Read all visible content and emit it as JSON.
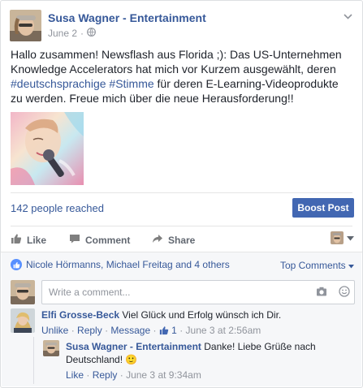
{
  "header": {
    "page_name": "Susa Wagner - Entertainment",
    "date": "June 2",
    "sep": "·"
  },
  "post": {
    "text_part1": "Hallo zusammen! Newsflash aus Florida ;): Das US-Unternehmen Knowledge Accelerators hat mich vor Kurzem ausgewählt, deren ",
    "hashtag1": "#deutschsprachige",
    "space": " ",
    "hashtag2": "#Stimme",
    "text_part2": " für deren E-Learning-Videoprodukte zu werden. Freue mich über die neue Herausforderung!!"
  },
  "insights": {
    "reach": "142 people reached",
    "boost_label": "Boost Post"
  },
  "actions": {
    "like": "Like",
    "comment": "Comment",
    "share": "Share"
  },
  "reactions": {
    "likers": "Nicole Hörmanns, Michael Freitag and 4 others",
    "sort_label": "Top Comments"
  },
  "composer": {
    "placeholder": "Write a comment..."
  },
  "comments": [
    {
      "author": "Elfi Grosse-Beck",
      "text": "Viel Glück und Erfolg wünsch ich Dir.",
      "unlike": "Unlike",
      "reply": "Reply",
      "message": "Message",
      "like_count": "1",
      "time": "June 3 at 2:56am"
    }
  ],
  "reply": {
    "author": "Susa Wagner - Entertainment",
    "text": "Danke! Liebe Grüße nach Deutschland! 🙂",
    "like": "Like",
    "reply": "Reply",
    "time": "June 3 at 9:34am"
  },
  "colors": {
    "brand_blue": "#4267b2",
    "link_blue": "#365899",
    "meta_gray": "#90949c"
  }
}
